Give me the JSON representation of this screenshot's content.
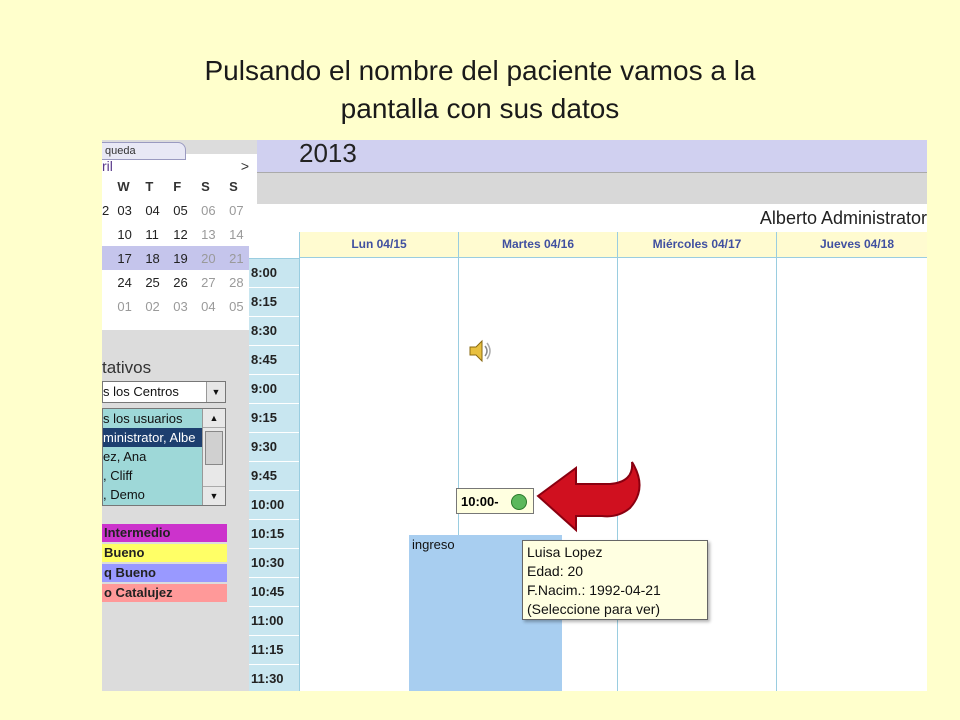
{
  "slide": {
    "title_line1": "Pulsando el nombre del paciente vamos a la",
    "title_line2": "pantalla con sus datos"
  },
  "calendar_tab": {
    "label": "queda"
  },
  "mini_calendar": {
    "month": "ril",
    "next": ">",
    "dow": [
      "",
      "W",
      "T",
      "F",
      "S",
      "S"
    ],
    "weeks": [
      [
        "2",
        "03",
        "04",
        "05",
        "06",
        "07"
      ],
      [
        "",
        "10",
        "11",
        "12",
        "13",
        "14"
      ],
      [
        "",
        "17",
        "18",
        "19",
        "20",
        "21"
      ],
      [
        "",
        "24",
        "25",
        "26",
        "27",
        "28"
      ],
      [
        "",
        "01",
        "02",
        "03",
        "04",
        "05"
      ]
    ]
  },
  "sidebar": {
    "section_title": "tativos",
    "centro_select": "s los Centros",
    "users": [
      "s los usuarios",
      "ministrator, Albe",
      "ez, Ana",
      ", Cliff",
      ", Demo"
    ],
    "legend": [
      {
        "label": "Intermedio",
        "color": "#cc33cc"
      },
      {
        "label": "Bueno",
        "color": "#ffff66"
      },
      {
        "label": "q Bueno",
        "color": "#9999ff"
      },
      {
        "label": "o Catalujez",
        "color": "#ff9999"
      }
    ]
  },
  "header": {
    "year": "2013",
    "user": "Alberto Administrator"
  },
  "grid": {
    "days": [
      "Lun 04/15",
      "Martes 04/16",
      "Miércoles 04/17",
      "Jueves 04/18"
    ],
    "times": [
      "8:00",
      "8:15",
      "8:30",
      "8:45",
      "9:00",
      "9:15",
      "9:30",
      "9:45",
      "10:00",
      "10:15",
      "10:30",
      "10:45",
      "11:00",
      "11:15",
      "11:30"
    ]
  },
  "appointment": {
    "block_label": "ingreso",
    "slot_label": "10:00-"
  },
  "tooltip": {
    "name": "Luisa Lopez",
    "age": "Edad: 20",
    "birth": "F.Nacim.: 1992-04-21",
    "hint": "(Seleccione para ver)"
  }
}
